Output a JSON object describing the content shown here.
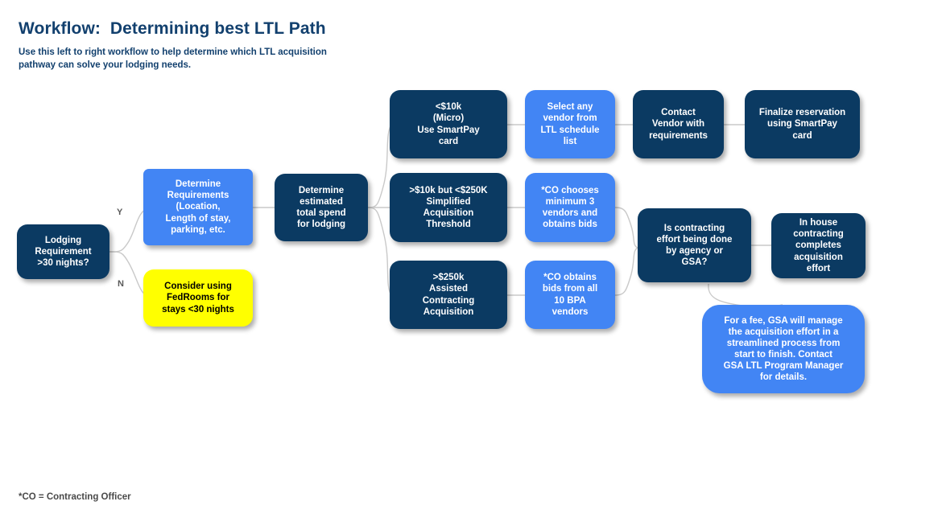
{
  "header": {
    "title": "Workflow:  Determining best LTL Path",
    "subtitle": "Use this left to right workflow to help determine which LTL acquisition pathway can solve your lodging needs.",
    "footnote": "*CO = Contracting Officer"
  },
  "colors": {
    "navy": "#0b3a62",
    "blue": "#4285f4",
    "yellow": "#ffff00",
    "title_blue": "#12406e",
    "connector_gray": "#c9c9c9",
    "background": "#ffffff"
  },
  "branch_labels": {
    "yes": "Y",
    "no": "N"
  },
  "nodes": {
    "start": "Lodging\nRequirement\n>30 nights?",
    "determine_requirements": "Determine\nRequirements\n(Location,\nLength of stay,\nparking, etc.",
    "fedrooms": "Consider using\nFedRooms for\nstays <30 nights",
    "estimated_spend": "Determine\nestimated\ntotal spend\nfor lodging",
    "micro": "<$10k\n(Micro)\nUse SmartPay\ncard",
    "simplified": ">$10k but <$250K\nSimplified\nAcquisition\nThreshold",
    "assisted": ">$250k\nAssisted\nContracting\nAcquisition",
    "select_vendor": "Select any\nvendor from\nLTL schedule\nlist",
    "co_chooses": "*CO chooses\nminimum 3\nvendors and\nobtains bids",
    "co_obtains": "*CO obtains\nbids from all\n10 BPA\nvendors",
    "contact_vendor": "Contact\nVendor with\nrequirements",
    "finalize": "Finalize reservation\nusing SmartPay\ncard",
    "contracting_question": "Is contracting\neffort being done\nby agency or\nGSA?",
    "in_house": "In house\ncontracting\ncompletes\nacquisition\neffort",
    "gsa_callout": "For a fee, GSA will manage\nthe acquisition effort in a\nstreamlined process from\nstart to finish.  Contact\nGSA LTL Program Manager\nfor details."
  }
}
